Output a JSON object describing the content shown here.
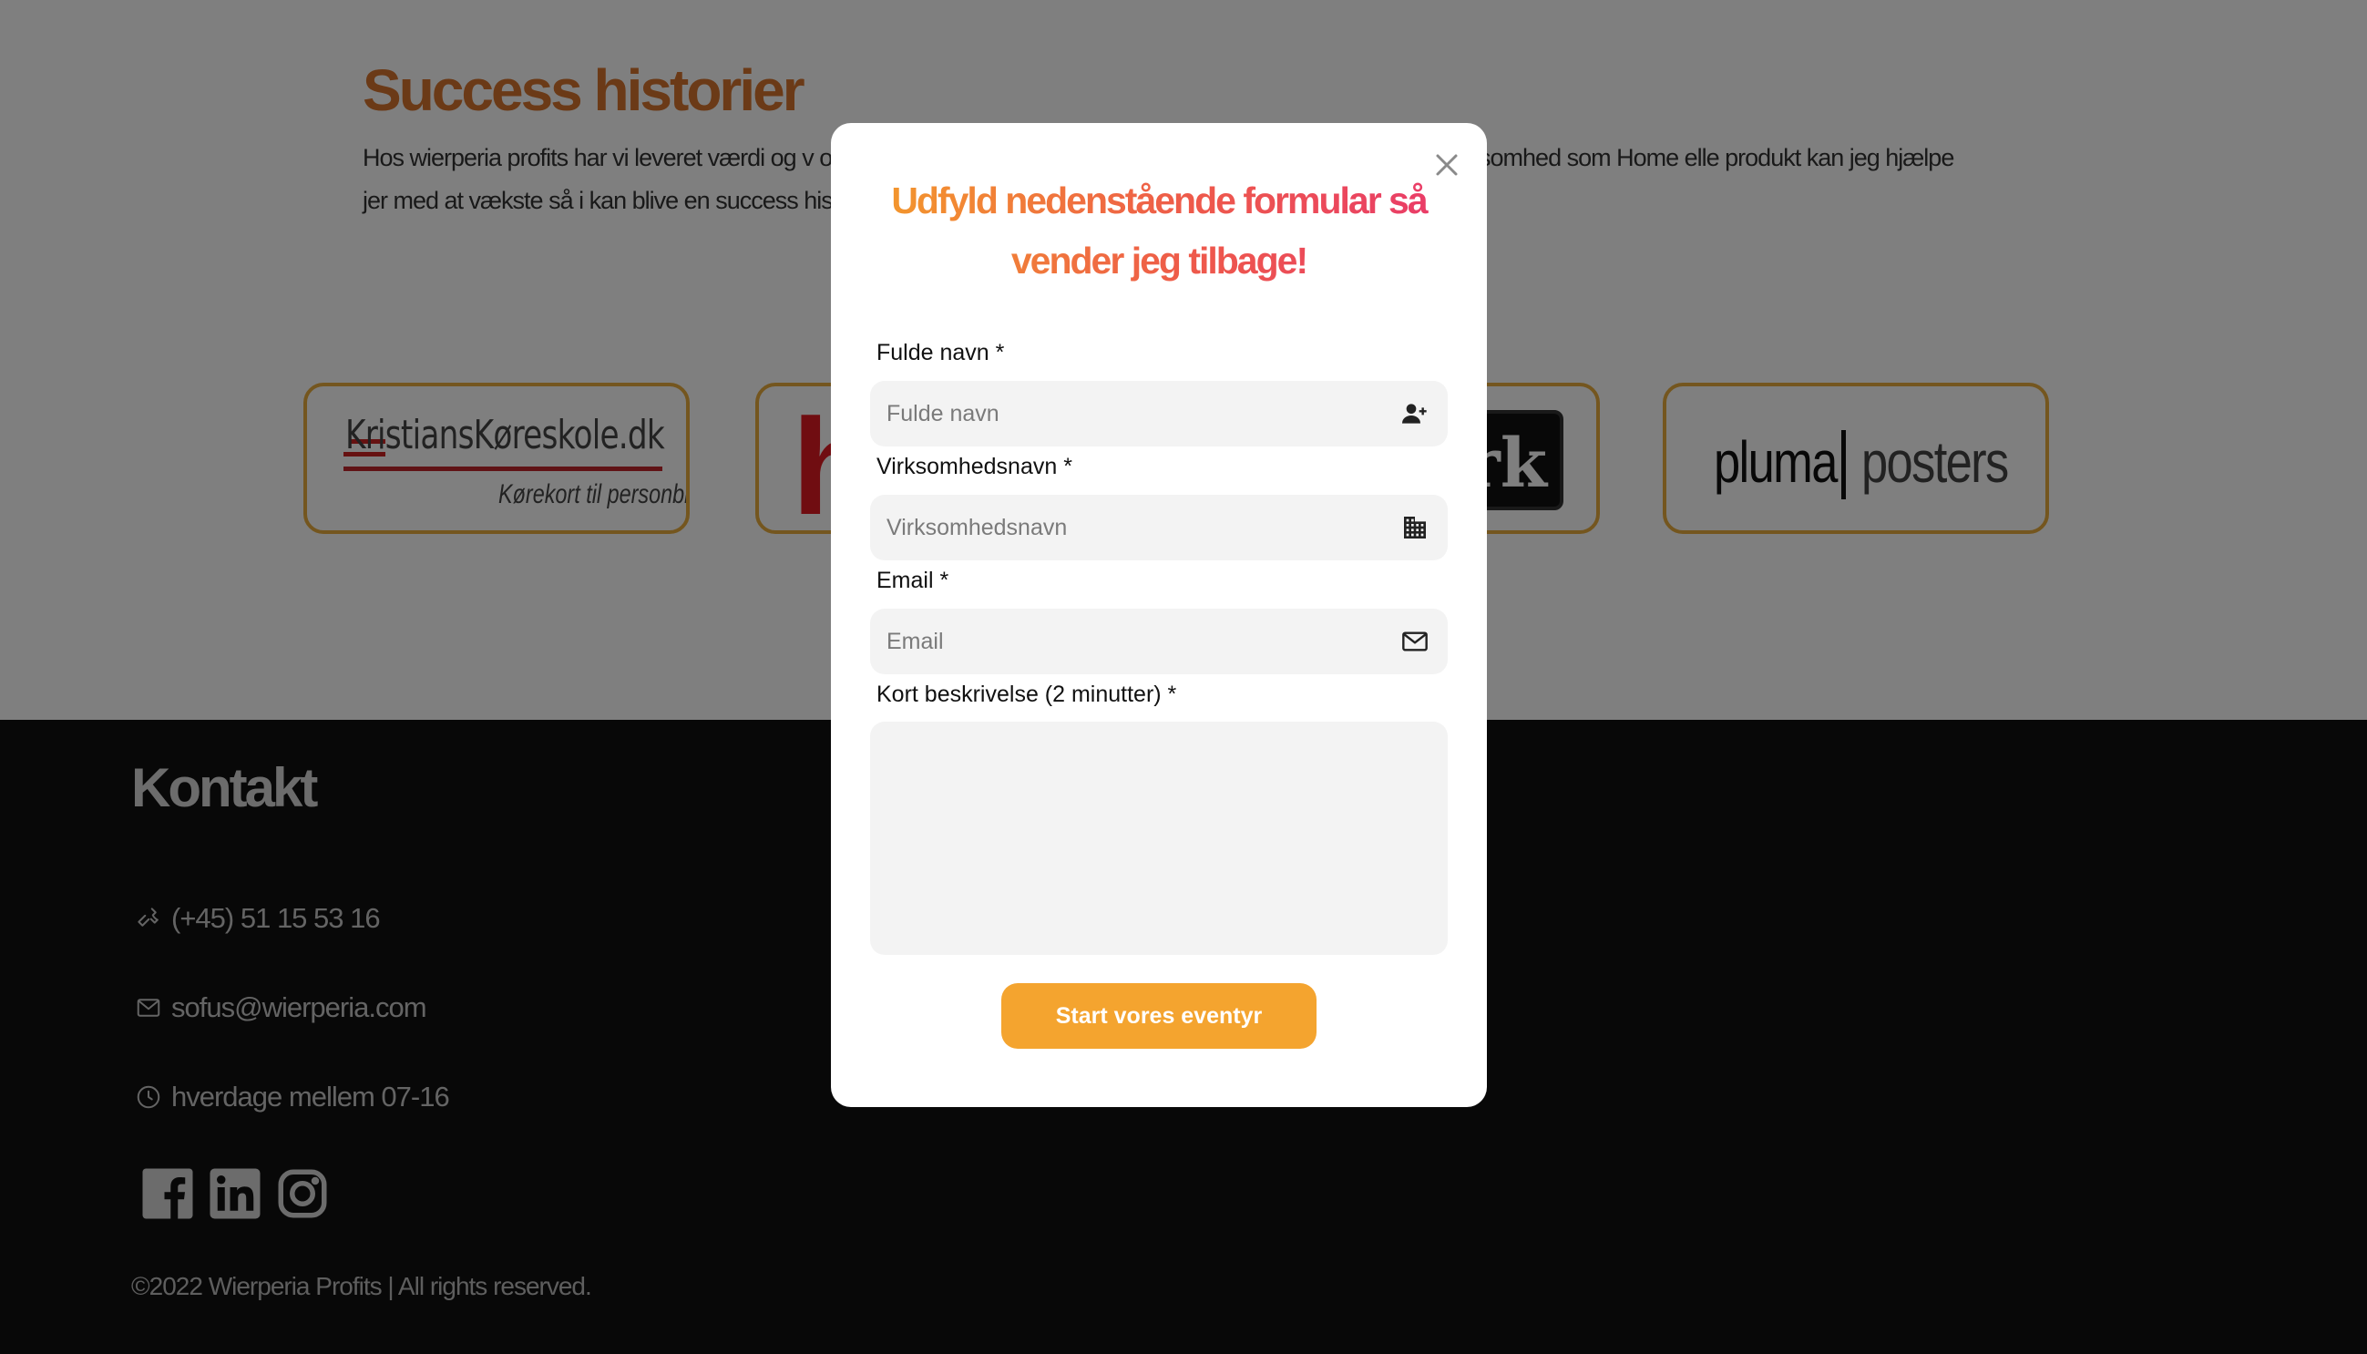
{
  "success": {
    "title": "Success historier",
    "text": "Hos wierperia profits har vi leveret værdi og v                                                       omheder. Eksempelvis har jeg leveret x antal værdi for en stor virksomhed som Home elle                                                      produkt kan jeg hjælpe jer med at vækste så i kan blive en success historie."
  },
  "logos": {
    "kristian_main": "KristiansKøreskole.dk",
    "kristian_sub": "Kørekort til personbil",
    "h_letter": "h",
    "rk_text": "rk",
    "pluma_word": "pluma",
    "pluma_sub": "posters"
  },
  "footer": {
    "title": "Kontakt",
    "phone": "(+45) 51 15 53 16",
    "email": "sofus@wierperia.com",
    "hours": "hverdage mellem 07-16",
    "socials": [
      "facebook-icon",
      "linkedin-icon",
      "instagram-icon"
    ],
    "copyright": "©2022 Wierperia Profits | All rights reserved."
  },
  "modal": {
    "heading": "Udfyld nedenstående formular så vender jeg tilbage!",
    "fields": {
      "name": {
        "label": "Fulde navn *",
        "placeholder": "Fulde navn",
        "icon": "person-add-icon"
      },
      "company": {
        "label": "Virksomhedsnavn *",
        "placeholder": "Virksomhedsnavn",
        "icon": "building-icon"
      },
      "email": {
        "label": "Email *",
        "placeholder": "Email",
        "icon": "envelope-icon"
      },
      "description": {
        "label": "Kort beskrivelse (2 minutter) *"
      }
    },
    "submit_label": "Start vores eventyr"
  },
  "colors": {
    "accent_orange": "#f4a42f",
    "heading_gradient_start": "#f39a2b",
    "heading_gradient_end": "#e93a6a",
    "logo_border": "#e9ad3e",
    "title_orange": "#d7752f"
  }
}
